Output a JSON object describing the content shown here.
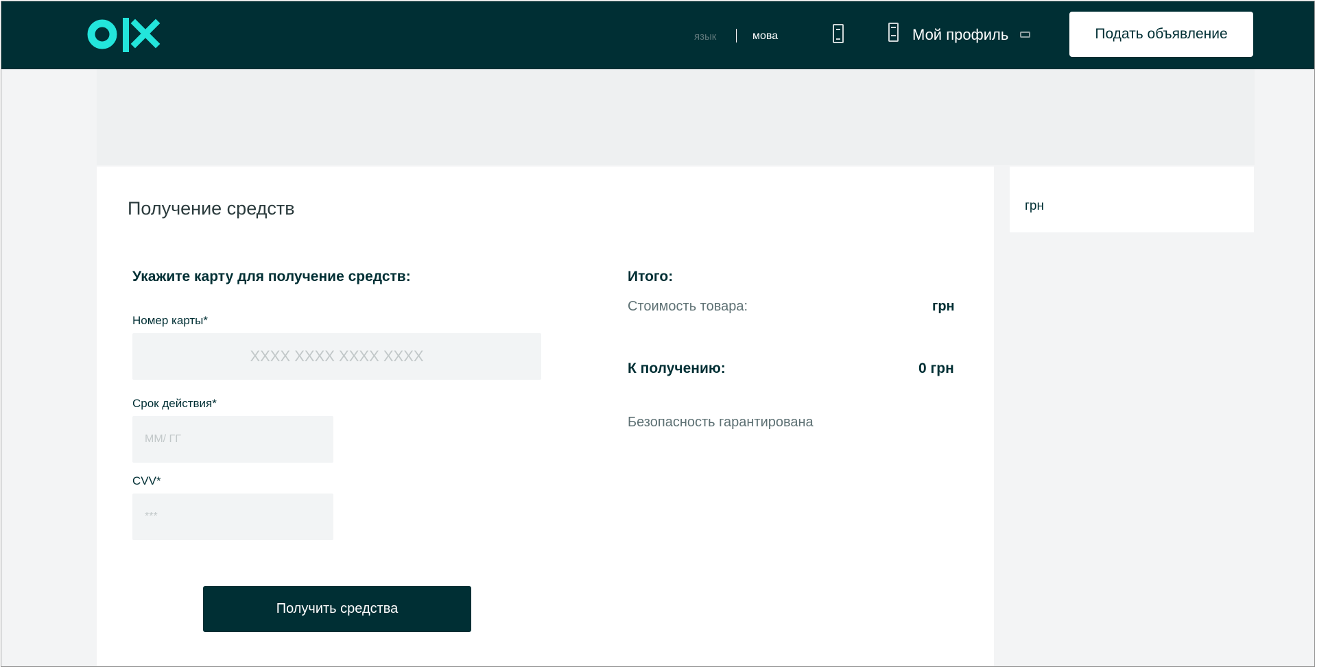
{
  "header": {
    "logo_text": "olx",
    "lang_ru": "язык",
    "lang_ua": "мова",
    "profile_label": "Мой профиль",
    "post_ad_label": "Подать объявление",
    "colors": {
      "header_bg": "#002f34",
      "logo": "#23e5db"
    },
    "icons": [
      "phone-icon",
      "profile-icon",
      "chat-icon"
    ]
  },
  "main": {
    "title": "Получение средств",
    "form": {
      "section_title": "Укажите карту для получение средств:",
      "card_number_label": "Номер карты*",
      "card_number_placeholder": "XXXX XXXX XXXX XXXX",
      "expiry_label": "Срок действия*",
      "expiry_placeholder": "ММ/ ГГ",
      "cvv_label": "CVV*",
      "cvv_placeholder": "***",
      "submit_label": "Получить средства"
    },
    "summary": {
      "title": "Итого:",
      "price_label": "Стоимость товара:",
      "price_value": "грн",
      "receive_label": "К получению:",
      "receive_value": "0 грн",
      "safety_text": "Безопасность гарантирована"
    }
  },
  "sidebar": {
    "amount": "грн"
  }
}
